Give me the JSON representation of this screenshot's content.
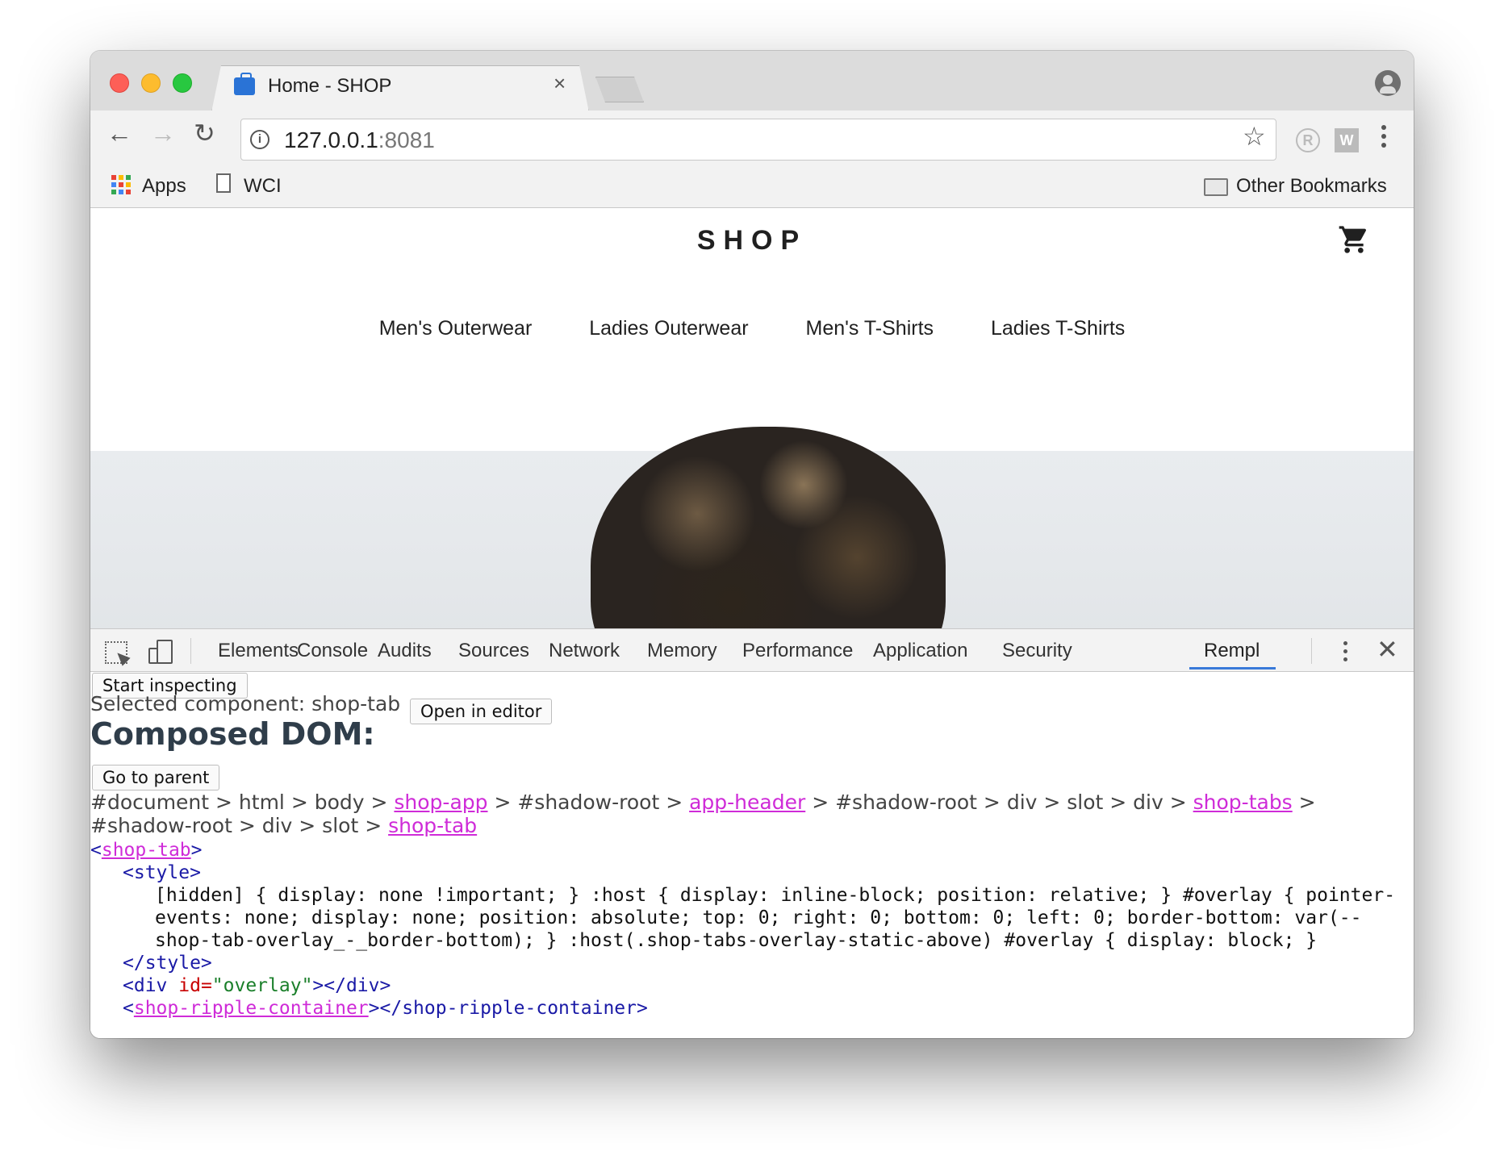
{
  "browser": {
    "tab_title": "Home - SHOP",
    "tab_close": "×",
    "url_host": "127.0.0.1",
    "url_port": ":8081",
    "bookmarks": [
      "Apps",
      "WCI"
    ],
    "other_bookmarks": "Other Bookmarks",
    "ext_r": "R",
    "ext_w": "W",
    "icons": {
      "back": "←",
      "forward": "→",
      "reload": "↻",
      "star": "☆",
      "info": "i"
    }
  },
  "shop": {
    "logo": "SHOP",
    "nav": [
      "Men's Outerwear",
      "Ladies Outerwear",
      "Men's T-Shirts",
      "Ladies T-Shirts"
    ]
  },
  "devtools": {
    "tabs": [
      "Elements",
      "Console",
      "Audits",
      "Sources",
      "Network",
      "Memory",
      "Performance",
      "Application",
      "Security",
      "Rempl"
    ],
    "active_tab": "Rempl",
    "close": "✕"
  },
  "panel": {
    "start_inspecting": "Start inspecting",
    "selected_label": "Selected component: shop-tab",
    "open_in_editor": "Open in editor",
    "composed_title": "Composed DOM:",
    "go_to_parent": "Go to parent",
    "crumbs": {
      "p1": "#document > html > body > ",
      "l1": "shop-app",
      "p2": " > #shadow-root > ",
      "l2": "app-header",
      "p3": " > #shadow-root > div > slot > div > ",
      "l3": "shop-tabs",
      "p4": " > #shadow-root > div > slot > ",
      "l4": "shop-tab"
    },
    "code": {
      "open_lt": "<",
      "open_tag": "shop-tab",
      "open_gt": ">",
      "style_open": "<style>",
      "css": "[hidden] { display: none !important; } :host { display: inline-block; position: relative; } #overlay { pointer-events: none; display: none; position: absolute; top: 0; right: 0; bottom: 0; left: 0; border-bottom: var(--shop-tab-overlay_-_border-bottom); } :host(.shop-tabs-overlay-static-above) #overlay { display: block; }",
      "style_close": "</style>",
      "div_open": "<div ",
      "div_attr": "id=",
      "div_val": "\"overlay\"",
      "div_close": "></div>",
      "ripple_lt": "<",
      "ripple_tag": "shop-ripple-container",
      "ripple_rest": "></shop-ripple-container>"
    }
  }
}
